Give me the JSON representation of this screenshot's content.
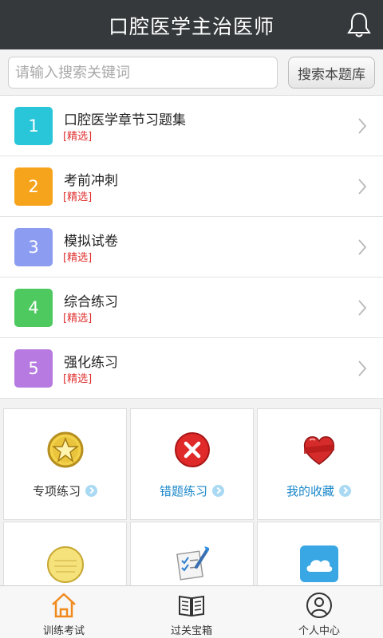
{
  "header": {
    "title": "口腔医学主治医师",
    "bell_icon": "bell-icon"
  },
  "search": {
    "placeholder": "请输入搜索关键词",
    "value": "",
    "button_label": "搜索本题库"
  },
  "list": {
    "items": [
      {
        "number": "1",
        "title": "口腔医学章节习题集",
        "tag": "[精选]",
        "color": "#29c5d9"
      },
      {
        "number": "2",
        "title": "考前冲刺",
        "tag": "[精选]",
        "color": "#f7a41d"
      },
      {
        "number": "3",
        "title": "模拟试卷",
        "tag": "[精选]",
        "color": "#8c9cf1"
      },
      {
        "number": "4",
        "title": "综合练习",
        "tag": "[精选]",
        "color": "#4dc960"
      },
      {
        "number": "5",
        "title": "强化练习",
        "tag": "[精选]",
        "color": "#b77ae0"
      }
    ]
  },
  "grid": {
    "items": [
      {
        "label": "专项练习",
        "icon": "star-badge-icon",
        "label_color": "#333333"
      },
      {
        "label": "错题练习",
        "icon": "wrong-x-icon",
        "label_color": "#1a87c9"
      },
      {
        "label": "我的收藏",
        "icon": "favorite-heart-icon",
        "label_color": "#1a87c9"
      },
      {
        "label": "",
        "icon": "notepad-icon"
      },
      {
        "label": "",
        "icon": "checklist-pen-icon"
      },
      {
        "label": "",
        "icon": "cloud-icon"
      }
    ]
  },
  "tabbar": {
    "tabs": [
      {
        "label": "训练考试",
        "icon": "home-icon",
        "active": true
      },
      {
        "label": "过关宝箱",
        "icon": "book-icon",
        "active": false
      },
      {
        "label": "个人中心",
        "icon": "user-icon",
        "active": false
      }
    ]
  },
  "colors": {
    "header_bg": "#35393b",
    "tag_red": "#e03030",
    "active_orange": "#f08a1c"
  }
}
